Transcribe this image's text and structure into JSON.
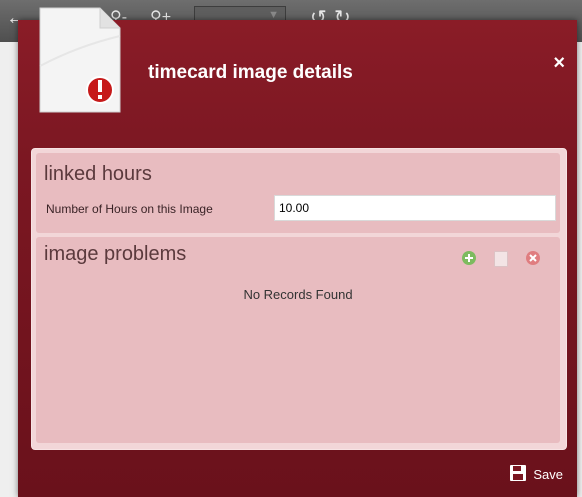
{
  "dialog": {
    "title": "timecard image details",
    "close_label": "×"
  },
  "linked_hours": {
    "title": "linked hours",
    "hours_label": "Number of Hours on this Image",
    "hours_value": "10.00"
  },
  "image_problems": {
    "title": "image problems",
    "empty_text": "No Records Found"
  },
  "footer": {
    "save_label": "Save"
  },
  "colors": {
    "dialog_bg": "#7b1722",
    "panel_bg": "#f2d6d8",
    "accent_green": "#6aa84f",
    "accent_red": "#d6453d"
  }
}
